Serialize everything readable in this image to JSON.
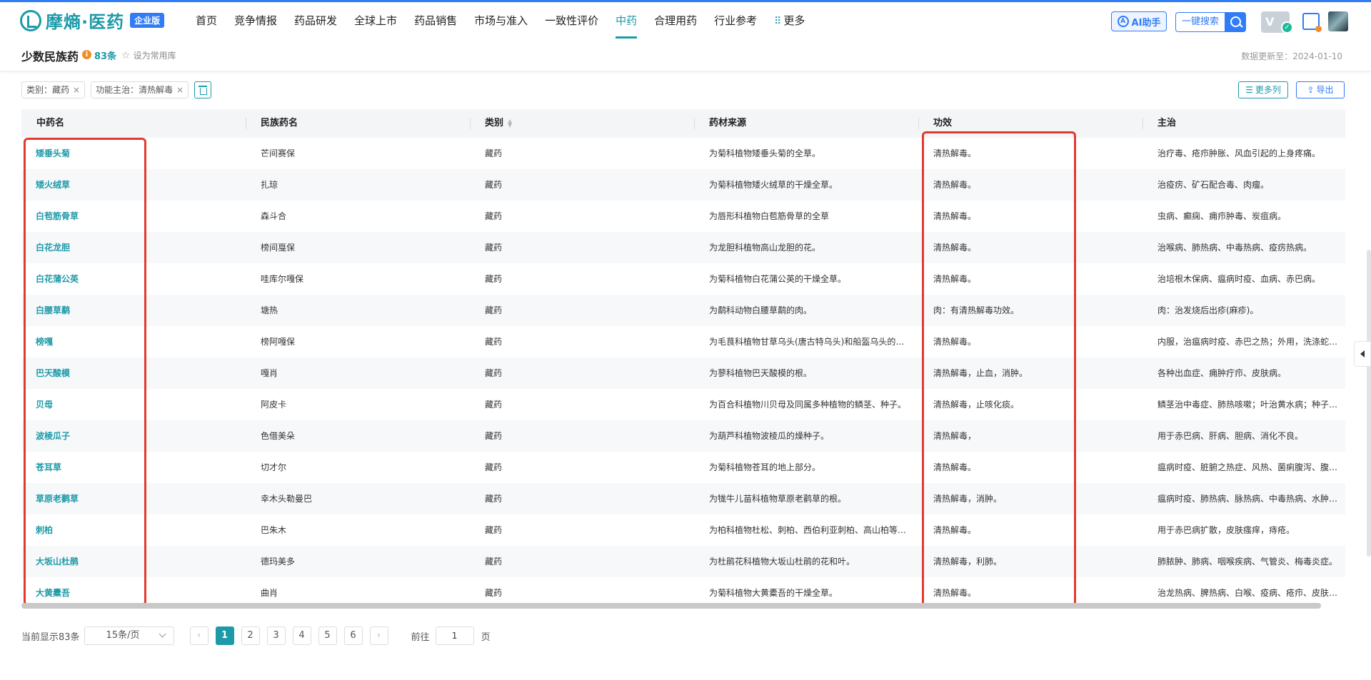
{
  "brand": {
    "name": "摩熵·医药",
    "badge": "企业版"
  },
  "nav": {
    "items": [
      "首页",
      "竞争情报",
      "药品研发",
      "全球上市",
      "药品销售",
      "市场与准入",
      "一致性评价",
      "中药",
      "合理用药",
      "行业参考",
      "更多"
    ],
    "active_index": 7
  },
  "header_right": {
    "ai_label": "AI助手",
    "search_label": "一键搜索",
    "vip_label": "V"
  },
  "page": {
    "title": "少数民族药",
    "count": "83条",
    "favorite_label": "设为常用库",
    "update_text": "数据更新至：2024-01-10"
  },
  "filters": [
    {
      "label": "类别：藏药"
    },
    {
      "label": "功能主治：清热解毒"
    }
  ],
  "actions": {
    "more_columns": "更多列",
    "export": "导出"
  },
  "table": {
    "columns": [
      "中药名",
      "民族药名",
      "类别",
      "药材来源",
      "功效",
      "主治"
    ],
    "rows": [
      [
        "矮垂头菊",
        "芒间赛保",
        "藏药",
        "为菊科植物矮垂头菊的全草。",
        "清热解毒。",
        "治疗毒、疮疖肿胀、风血引起的上身疼痛。"
      ],
      [
        "矮火绒草",
        "扎琼",
        "藏药",
        "为菊科植物矮火绒草的干燥全草。",
        "清热解毒。",
        "治疫疠、矿石配合毒、肉瘤。"
      ],
      [
        "白苞筋骨草",
        "森斗合",
        "藏药",
        "为唇形科植物白苞筋骨草的全草",
        "清热解毒。",
        "虫病、癫痫、痈疖肿毒、炭疽病。"
      ],
      [
        "白花龙胆",
        "榜间戛保",
        "藏药",
        "为龙胆科植物高山龙胆的花。",
        "清热解毒。",
        "治喉病、肺热病、中毒热病、疫疠热病。"
      ],
      [
        "白花蒲公英",
        "哇库尔嘎保",
        "藏药",
        "为菊科植物白花蒲公英的干燥全草。",
        "清热解毒。",
        "治培根木保病、瘟病时疫、血病、赤巴病。"
      ],
      [
        "白腰草鹬",
        "塘热",
        "藏药",
        "为鹬科动物白腰草鹬的肉。",
        "肉：有清热解毒功效。",
        "肉：治发烧后出疹(麻疹)。"
      ],
      [
        "榜嘎",
        "榜阿嘎保",
        "藏药",
        "为毛茛科植物甘草乌头(唐古特乌头)和船盔乌头的全草。",
        "清热解毒。",
        "内服，治瘟病时疫、赤巴之热；外用，洗涤蛇咬伤。"
      ],
      [
        "巴天酸模",
        "嘎肖",
        "藏药",
        "为蓼科植物巴天酸模的根。",
        "清热解毒，止血，消肿。",
        "各种出血症、痈肿疔疖、皮肤病。"
      ],
      [
        "贝母",
        "阿皮卡",
        "藏药",
        "为百合科植物川贝母及同属多种植物的鳞茎、种子。",
        "清热解毒，止咳化痰。",
        "鳞茎治中毒症、肺热咳嗽；叶治黄水病；种子治头痛。"
      ],
      [
        "波棱瓜子",
        "色借美朵",
        "藏药",
        "为葫芦科植物波棱瓜的燥种子。",
        "清热解毒，",
        "用于赤巴病、肝病、胆病、消化不良。"
      ],
      [
        "苍耳草",
        "切才尔",
        "藏药",
        "为菊科植物苍耳的地上部分。",
        "清热解毒。",
        "瘟病时疫、脏腑之热症、风热、菌痢腹泻、腹痛。"
      ],
      [
        "草原老鹳草",
        "幸木头勒曼巴",
        "藏药",
        "为牻牛儿苗科植物草原老鹳草的根。",
        "清热解毒，消肿。",
        "瘟病时疫、肺热病、脉热病、中毒热病、水肿病。"
      ],
      [
        "刺柏",
        "巴朱木",
        "藏药",
        "为柏科植物杜松、刺柏、西伯利亚刺柏、高山柏等的枝叶。",
        "清热解毒。",
        "用于赤巴病扩散，皮肤瘙痒，痔疮。"
      ],
      [
        "大坂山杜鹃",
        "德玛美多",
        "藏药",
        "为杜鹃花科植物大坂山杜鹃的花和叶。",
        "清热解毒，利肺。",
        "肺脓肿、肺病、咽喉疾病、气管炎、梅毒炎症。"
      ],
      [
        "大黄橐吾",
        "曲肖",
        "藏药",
        "为菊科植物大黄橐吾的干燥全草。",
        "清热解毒。",
        "治龙热病、脾热病、白喉、疫病、疮疖、皮肤病。"
      ]
    ]
  },
  "pagination": {
    "total_text": "当前显示83条",
    "page_size": "15条/页",
    "pages": [
      "1",
      "2",
      "3",
      "4",
      "5",
      "6"
    ],
    "current_page": "1",
    "goto_prefix": "前往",
    "goto_value": "1",
    "goto_suffix": "页"
  },
  "colors": {
    "brand": "#1d9aa8",
    "accent": "#2f7cf6",
    "highlight": "#e33a2f",
    "warning": "#f08c2b"
  }
}
